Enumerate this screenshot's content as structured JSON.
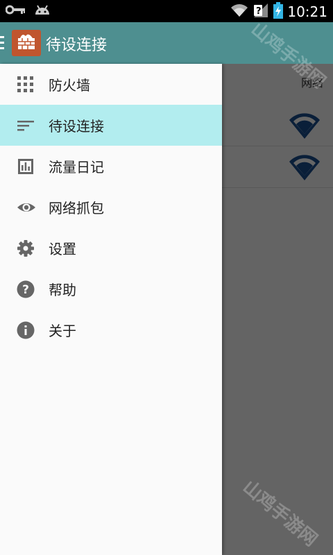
{
  "status_bar": {
    "time": "10:21",
    "left_icons": [
      "key-icon",
      "android-icon"
    ],
    "right_icons": [
      "wifi-icon",
      "no-sim-icon",
      "battery-charging-icon"
    ]
  },
  "app_bar": {
    "title": "待设连接",
    "color": "#4E8F90",
    "logo_color": "#C0552E"
  },
  "content": {
    "column_header": "网络",
    "rows": [
      {
        "icon": "wifi-signal-icon"
      },
      {
        "icon": "wifi-signal-icon"
      }
    ]
  },
  "drawer": {
    "items": [
      {
        "label": "防火墙",
        "icon": "grid-icon",
        "selected": false
      },
      {
        "label": "待设连接",
        "icon": "sort-lines-icon",
        "selected": true
      },
      {
        "label": "流量日记",
        "icon": "bar-chart-icon",
        "selected": false
      },
      {
        "label": "网络抓包",
        "icon": "eye-icon",
        "selected": false
      },
      {
        "label": "设置",
        "icon": "gear-icon",
        "selected": false
      },
      {
        "label": "帮助",
        "icon": "help-icon",
        "selected": false
      },
      {
        "label": "关于",
        "icon": "info-icon",
        "selected": false
      }
    ],
    "selected_color": "#B2EDEF"
  },
  "watermark": "山鸡手游网"
}
